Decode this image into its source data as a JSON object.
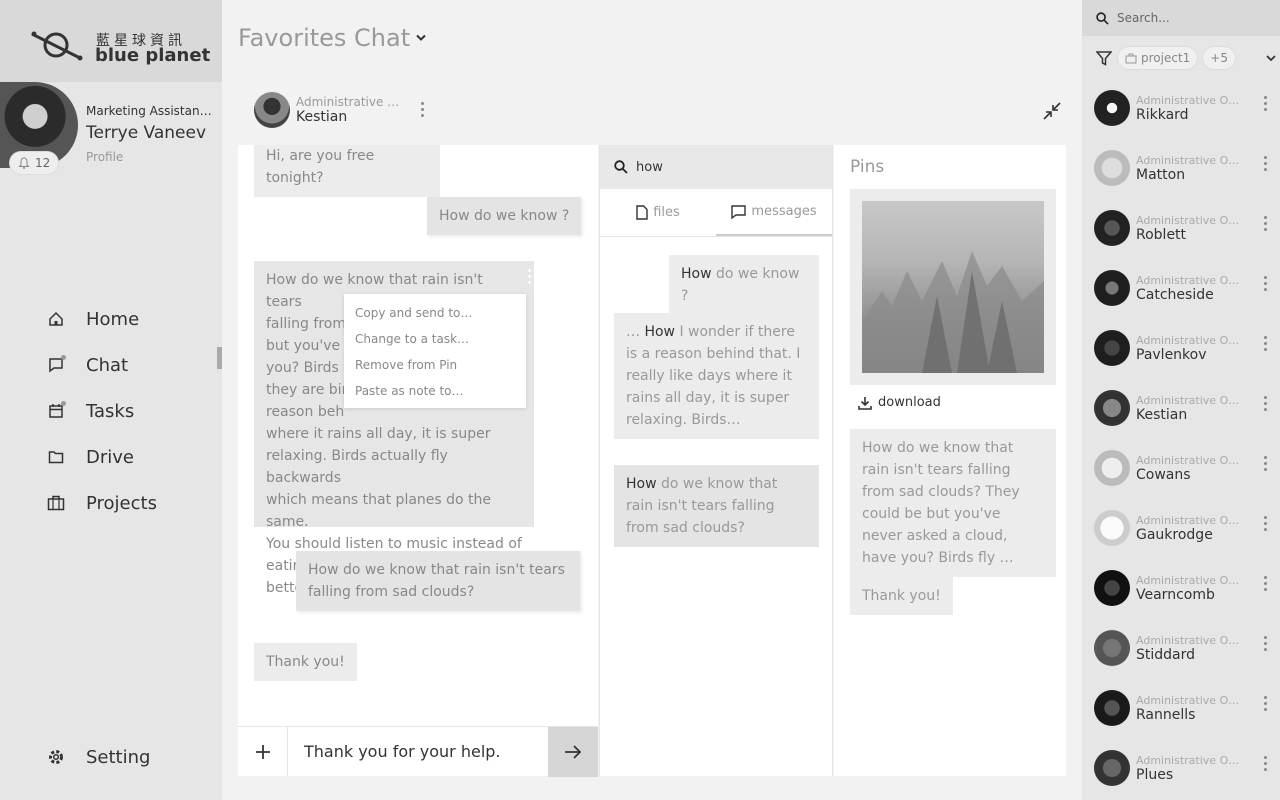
{
  "brand": {
    "cn": "藍星球資訊",
    "en": "blue planet"
  },
  "profile": {
    "role": "Marketing Assistant…",
    "name": "Terrye Vaneev",
    "link": "Profile",
    "notifications": "12"
  },
  "nav": [
    {
      "label": "Home",
      "icon": "home-icon"
    },
    {
      "label": "Chat",
      "icon": "chat-icon"
    },
    {
      "label": "Tasks",
      "icon": "calendar-icon"
    },
    {
      "label": "Drive",
      "icon": "folder-icon"
    },
    {
      "label": "Projects",
      "icon": "briefcase-icon"
    }
  ],
  "setting": {
    "label": "Setting",
    "icon": "gear-icon"
  },
  "page": {
    "title": "Favorites Chat"
  },
  "contact": {
    "role": "Administrative O…",
    "name": "Kestian"
  },
  "chat": {
    "messages": [
      {
        "text": "Hi, are you free tonight?"
      },
      {
        "text": "How do we know ?"
      },
      {
        "text": "How do we know that rain isn't tears falling from sad clouds? They could be but you've never asked a cloud, have you? Birds fly … they are birds and … a reason behind … where it rains all day, it is super relaxing. Birds actually fly backwards which means that planes do the same. You should listen to music instead of eating. It makes you feel much better.",
        "lines": [
          "How do we know that rain isn't tears",
          "falling from",
          "but you've n",
          " you? Birds",
          "they are bir",
          " reason beh",
          "where it rains all day, it is super",
          "relaxing. Birds actually fly backwards",
          "which means that planes do the same.",
          "You should listen to music instead of",
          "eating. It makes you feel much better."
        ]
      },
      {
        "text": "How do we know that rain isn't tears falling from sad clouds?"
      },
      {
        "text": "Thank you!"
      }
    ],
    "context_menu": [
      "Copy and send to…",
      "Change to a task…",
      "Remove from Pin",
      "Paste as note to…"
    ],
    "composer_value": "Thank you for your help."
  },
  "search_panel": {
    "query": "how",
    "tabs": [
      {
        "label": "files"
      },
      {
        "label": "messages"
      }
    ],
    "results": [
      {
        "highlight": "How",
        "rest": " do we know ?"
      },
      {
        "prefix": "… ",
        "highlight": "How",
        "rest": " I wonder if there is a reason behind that. I really like days where it rains all day, it is super relaxing. Birds…"
      },
      {
        "highlight": "How",
        "rest": " do we know that rain isn't tears falling from sad clouds?"
      }
    ]
  },
  "pins": {
    "title": "Pins",
    "download": "download",
    "items": [
      {
        "text": "How do we know that rain isn't tears falling from sad clouds? They could be but you've never asked a cloud, have you? Birds fly …"
      },
      {
        "text": "Thank you!"
      }
    ]
  },
  "right": {
    "search_placeholder": "Search...",
    "filter_chip": "project1",
    "filter_more": "+5",
    "contacts": [
      {
        "role": "Administrative O…",
        "name": "Rikkard"
      },
      {
        "role": "Administrative O…",
        "name": "Matton"
      },
      {
        "role": "Administrative O…",
        "name": "Roblett"
      },
      {
        "role": "Administrative O…",
        "name": "Catcheside"
      },
      {
        "role": "Administrative O…",
        "name": "Pavlenkov"
      },
      {
        "role": "Administrative O…",
        "name": "Kestian"
      },
      {
        "role": "Administrative O…",
        "name": "Cowans"
      },
      {
        "role": "Administrative O…",
        "name": "Gaukrodge"
      },
      {
        "role": "Administrative O…",
        "name": "Vearncomb"
      },
      {
        "role": "Administrative O…",
        "name": "Stiddard"
      },
      {
        "role": "Administrative O…",
        "name": "Rannells"
      },
      {
        "role": "Administrative O…",
        "name": "Plues"
      }
    ]
  }
}
